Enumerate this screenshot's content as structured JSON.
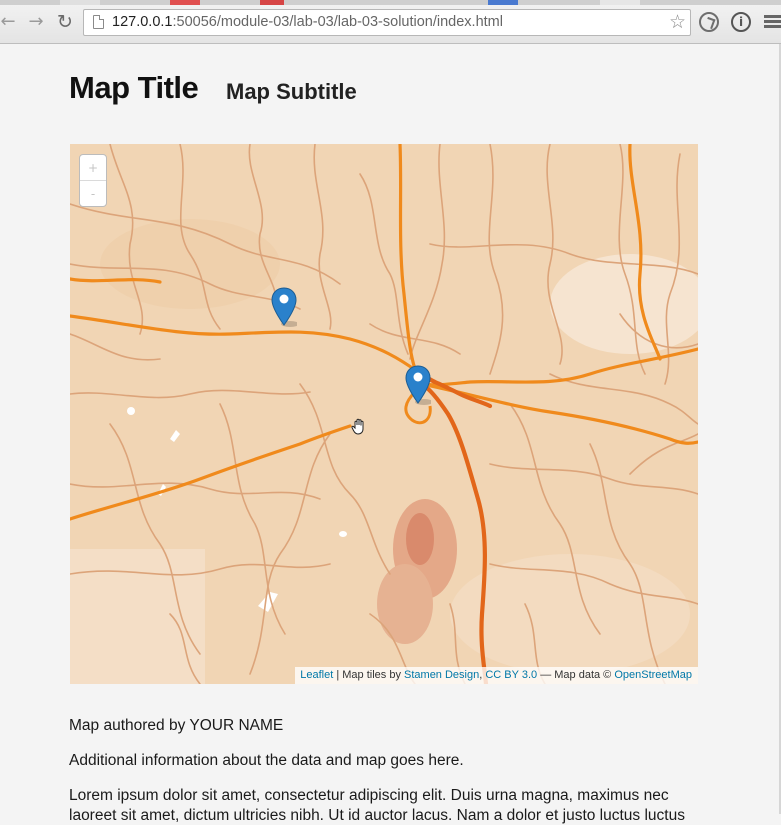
{
  "browser": {
    "url_host": "127.0.0.1",
    "url_rest": ":50056/module-03/lab-03/lab-03-solution/index.html",
    "icons": [
      "back-arrow-icon",
      "forward-arrow-icon",
      "reload-icon",
      "page-icon",
      "star-icon",
      "sync-icon",
      "info-icon",
      "menu-icon"
    ]
  },
  "page": {
    "title": "Map Title",
    "subtitle": "Map Subtitle"
  },
  "map": {
    "zoom_in_label": "+",
    "zoom_out_label": "-",
    "markers": [
      "marker-north-west",
      "marker-center"
    ],
    "tile_colors": {
      "land": "#f1d5b4",
      "roads": "#f08a1c",
      "major_road": "#e2661a",
      "minor_roads": "#d9a070"
    },
    "attribution": {
      "leaflet": "Leaflet",
      "tiles_by": " | Map tiles by ",
      "stamen": "Stamen Design",
      "comma": ", ",
      "license": "CC BY 3.0",
      "data_text": " — Map data © ",
      "osm": "OpenStreetMap"
    }
  },
  "content": {
    "author_line": "Map authored by YOUR NAME",
    "info_line": "Additional information about the data and map goes here.",
    "lorem_line_1": "Lorem ipsum dolor sit amet, consectetur adipiscing elit. Duis urna magna, maximus nec",
    "lorem_line_2": "laoreet sit amet, dictum ultricies nibh. Ut id auctor lacus. Nam a dolor et justo luctus luctus"
  }
}
